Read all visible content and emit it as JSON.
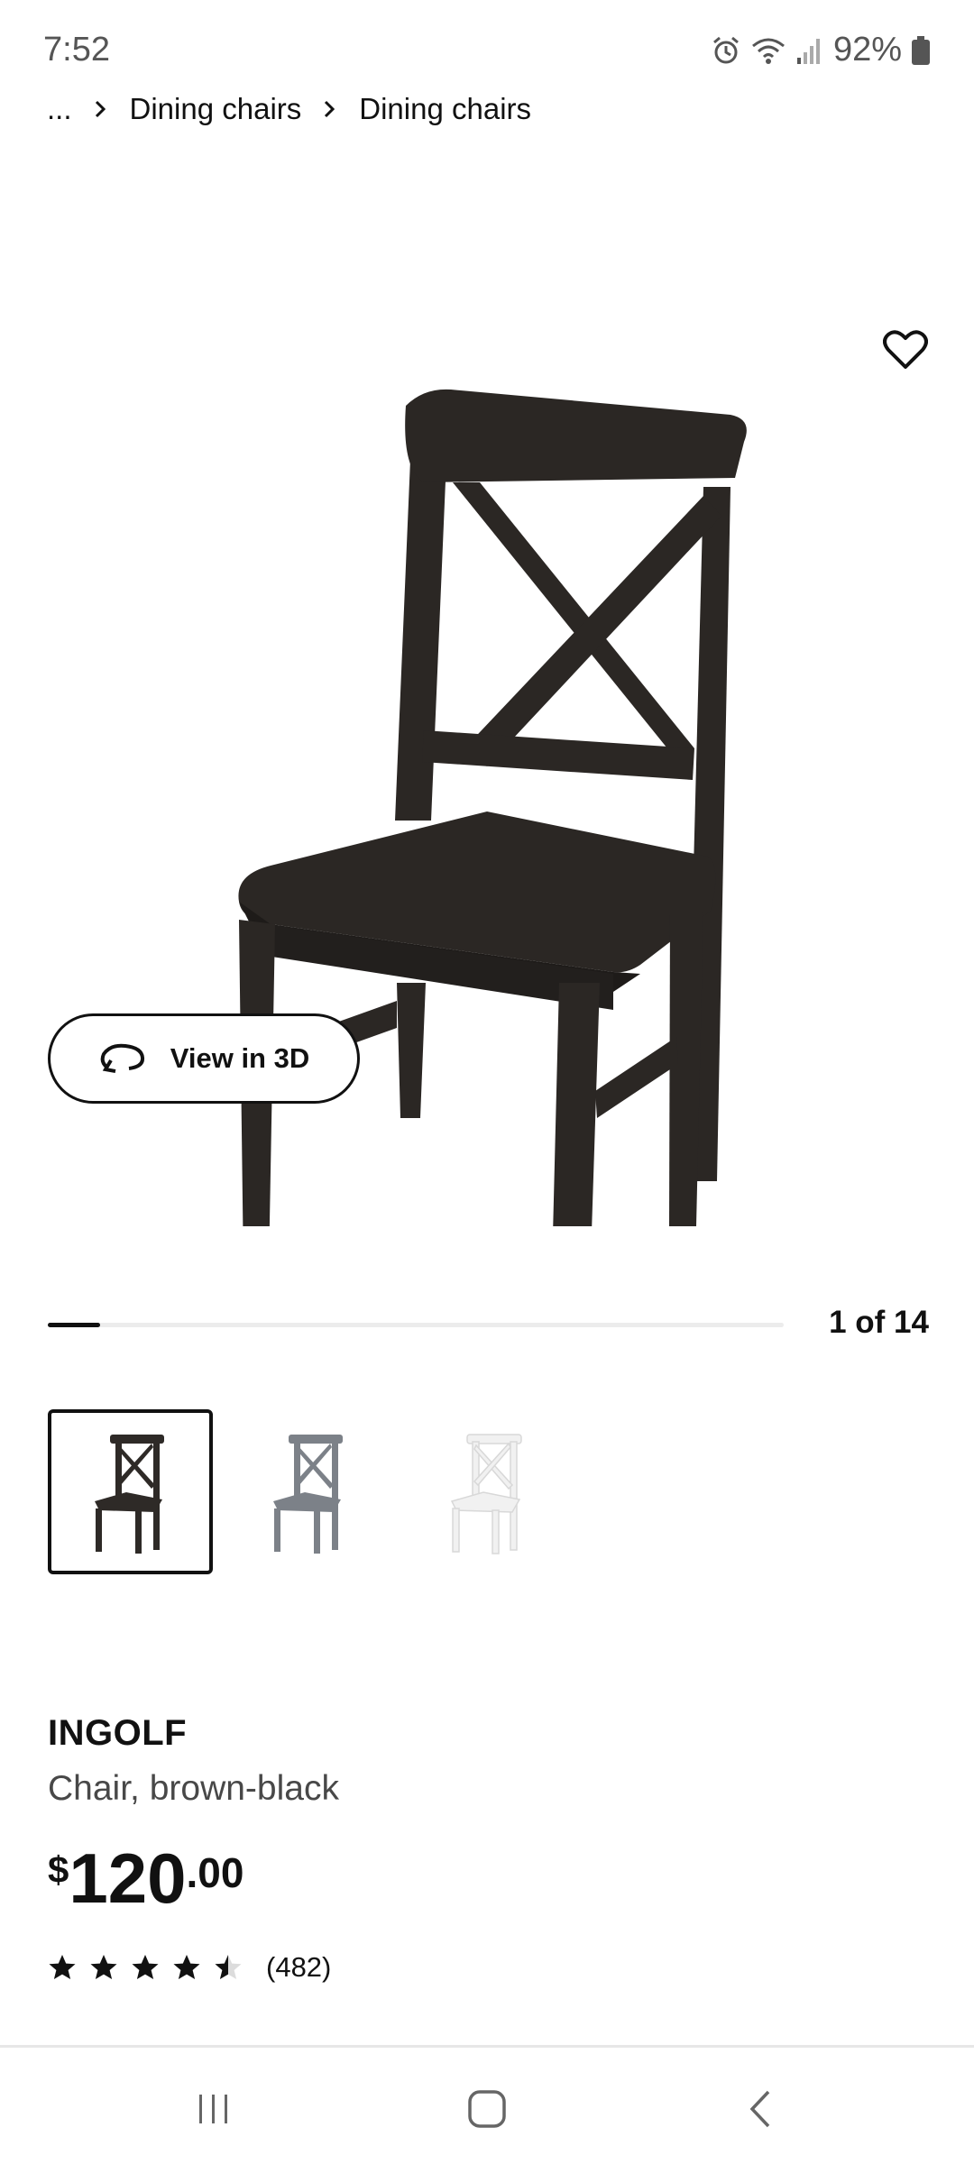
{
  "status": {
    "time": "7:52",
    "battery": "92%",
    "icons": [
      "alarm-icon",
      "wifi-icon",
      "signal-icon",
      "battery-icon"
    ]
  },
  "breadcrumb": {
    "ellipsis": "...",
    "items": [
      "Dining chairs",
      "Dining chairs"
    ]
  },
  "gallery": {
    "view3d_label": "View in 3D",
    "counter": "1 of 14",
    "current": 1,
    "total": 14,
    "thumbnails": [
      {
        "name": "brown-black",
        "color": "#2e2a27"
      },
      {
        "name": "gray",
        "color": "#7c8188"
      },
      {
        "name": "white",
        "color": "#f1f1f1"
      }
    ]
  },
  "product": {
    "name": "INGOLF",
    "description": "Chair, brown-black",
    "price_currency": "$",
    "price_integer": "120",
    "price_decimal": ".00",
    "rating": 4.5,
    "review_count": "(482)"
  },
  "colors": {
    "chair_main": "#2b2724",
    "text": "#111111",
    "muted": "#484848"
  }
}
